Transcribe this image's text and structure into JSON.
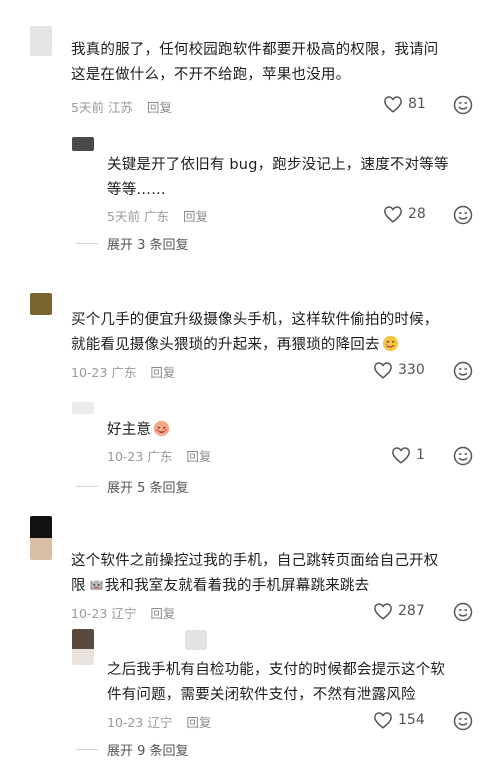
{
  "comments": [
    {
      "text_line1": "我真的服了，任何校园跑软件都要开极高的权限，我请问",
      "text_line2": "这是在做什么，不开不给跑，苹果也没用。",
      "time": "5天前",
      "location": "江苏",
      "reply_label": "回复",
      "likes": "81",
      "avatar_color": "#e4e4e4"
    },
    {
      "text_line1": "关键是开了依旧有 bug，跑步没记上，速度不对等等",
      "text_line2": "等等……",
      "time": "5天前",
      "location": "广东",
      "reply_label": "回复",
      "likes": "28",
      "avatar_color": "#4a4a4a"
    },
    {
      "text_line1": "买个几手的便宜升级摄像头手机，这样软件偷拍的时候，",
      "text_line2": "就能看见摄像头猥琐的升起来，再猥琐的降回去",
      "time": "10-23",
      "location": "广东",
      "reply_label": "回复",
      "likes": "330",
      "avatar_color": "#7a6530"
    },
    {
      "text_line1": "好主意",
      "time": "10-23",
      "location": "广东",
      "reply_label": "回复",
      "likes": "1",
      "avatar_color": "#ececec"
    },
    {
      "text_line1": "这个软件之前操控过我的手机，自己跳转页面给自己开权",
      "text_line2_a": "限",
      "text_line2_b": "我和我室友就看着我的手机屏幕跳来跳去",
      "time": "10-23",
      "location": "辽宁",
      "reply_label": "回复",
      "likes": "287",
      "avatar_color": "#111111"
    },
    {
      "text_line1": "之后我手机有自检功能，支付的时候都会提示这个软",
      "text_line2": "件有问题，需要关闭软件支付，不然有泄露风险",
      "time": "10-23",
      "location": "辽宁",
      "reply_label": "回复",
      "likes": "154",
      "avatar_color": "#5a4a3e"
    }
  ],
  "expand_1": "展开 3 条回复",
  "expand_2": "展开 5 条回复",
  "expand_3": "展开 9 条回复",
  "colors": {
    "text": "#1d1d1d",
    "meta": "#9a9a9a",
    "icon": "#555555"
  }
}
